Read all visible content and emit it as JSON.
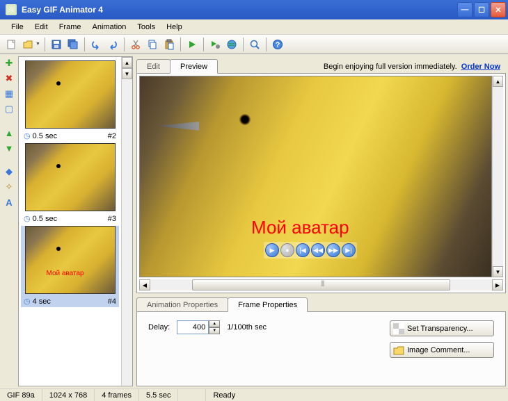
{
  "title": "Easy GIF Animator 4",
  "menubar": [
    "File",
    "Edit",
    "Frame",
    "Animation",
    "Tools",
    "Help"
  ],
  "frames": [
    {
      "delay": "0.5 sec",
      "num": "#2",
      "hasText": false
    },
    {
      "delay": "0.5 sec",
      "num": "#3",
      "hasText": false
    },
    {
      "delay": "4 sec",
      "num": "#4",
      "hasText": true,
      "selected": true
    }
  ],
  "topTabs": {
    "edit": "Edit",
    "preview": "Preview"
  },
  "promo": {
    "text": "Begin enjoying full version immediately.",
    "link": "Order Now"
  },
  "previewOverlayText": "Мой аватар",
  "propTabs": {
    "anim": "Animation Properties",
    "frame": "Frame Properties"
  },
  "props": {
    "delayLabel": "Delay:",
    "delayValue": "400",
    "delayUnit": "1/100th sec",
    "btnTransparency": "Set Transparency...",
    "btnComment": "Image Comment..."
  },
  "status": {
    "format": "GIF 89a",
    "size": "1024 x 768",
    "frames": "4 frames",
    "duration": "5.5 sec",
    "ready": "Ready"
  }
}
